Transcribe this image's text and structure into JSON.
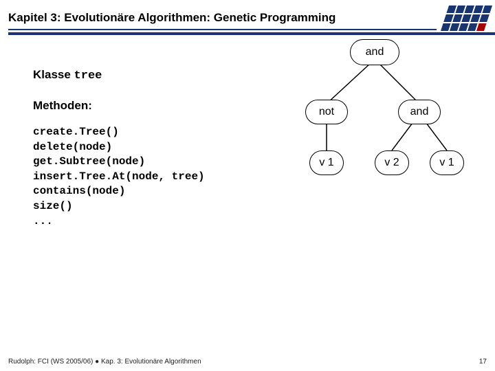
{
  "header": {
    "title": "Kapitel 3: Evolutionäre Algorithmen: Genetic Programming"
  },
  "klasse": {
    "label": "Klasse ",
    "name": "tree"
  },
  "methoden_label": "Methoden:",
  "methods": "create.Tree()\ndelete(node)\nget.Subtree(node)\ninsert.Tree.At(node, tree)\ncontains(node)\nsize()\n...",
  "tree": {
    "root": "and",
    "l": "not",
    "r": "and",
    "ll": "v 1",
    "rl": "v 2",
    "rr": "v 1"
  },
  "footer": {
    "left": "Rudolph: FCI (WS 2005/06) ● Kap. 3: Evolutionäre Algorithmen",
    "page": "17"
  }
}
